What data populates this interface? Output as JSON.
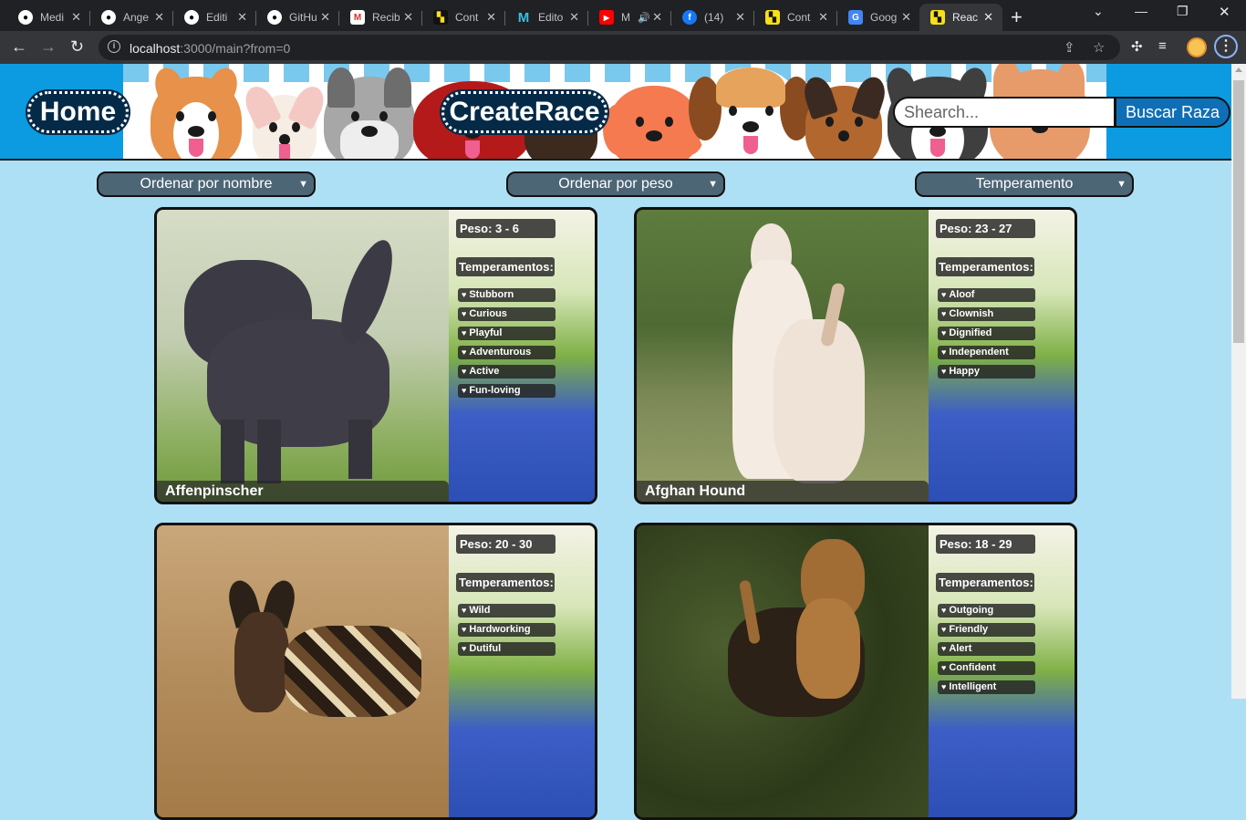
{
  "browser": {
    "tabs": [
      {
        "title": "Medi",
        "icon": "github-icon"
      },
      {
        "title": "Ange",
        "icon": "github-icon"
      },
      {
        "title": "Editi",
        "icon": "github-icon"
      },
      {
        "title": "GitHu",
        "icon": "github-icon"
      },
      {
        "title": "Recib",
        "icon": "gmail-icon"
      },
      {
        "title": "Cont",
        "icon": "content-icon"
      },
      {
        "title": "Edito",
        "icon": "editor-icon"
      },
      {
        "title": "M",
        "icon": "youtube-icon"
      },
      {
        "title": "(14)",
        "icon": "facebook-icon"
      },
      {
        "title": "Cont",
        "icon": "content-icon"
      },
      {
        "title": "Goog",
        "icon": "google-translate-icon"
      },
      {
        "title": "Reac",
        "icon": "react-app-icon"
      }
    ],
    "url_host": "localhost",
    "url_rest": ":3000/main?from=0"
  },
  "header": {
    "home_label": "Home",
    "create_label": "CreateRace",
    "search_placeholder": "Shearch...",
    "search_button": "Buscar Raza"
  },
  "filters": {
    "by_name": "Ordenar por nombre",
    "by_weight": "Ordenar por peso",
    "temperament": "Temperamento"
  },
  "cards": [
    {
      "name": "Affenpinscher",
      "weight": "Peso: 3 - 6",
      "temperament_label": "Temperamentos:",
      "temperaments": [
        "Stubborn",
        "Curious",
        "Playful",
        "Adventurous",
        "Active",
        "Fun-loving"
      ]
    },
    {
      "name": "Afghan Hound",
      "weight": "Peso: 23 - 27",
      "temperament_label": "Temperamentos:",
      "temperaments": [
        "Aloof",
        "Clownish",
        "Dignified",
        "Independent",
        "Happy"
      ]
    },
    {
      "name": "",
      "weight": "Peso: 20 - 30",
      "temperament_label": "Temperamentos:",
      "temperaments": [
        "Wild",
        "Hardworking",
        "Dutiful"
      ]
    },
    {
      "name": "",
      "weight": "Peso: 18 - 29",
      "temperament_label": "Temperamentos:",
      "temperaments": [
        "Outgoing",
        "Friendly",
        "Alert",
        "Confident",
        "Intelligent"
      ]
    }
  ],
  "colors": {
    "page_bg": "#aee0f5",
    "banner_blue": "#0c9be0",
    "button_dark": "#052a47",
    "select_bg": "#4d6676"
  }
}
